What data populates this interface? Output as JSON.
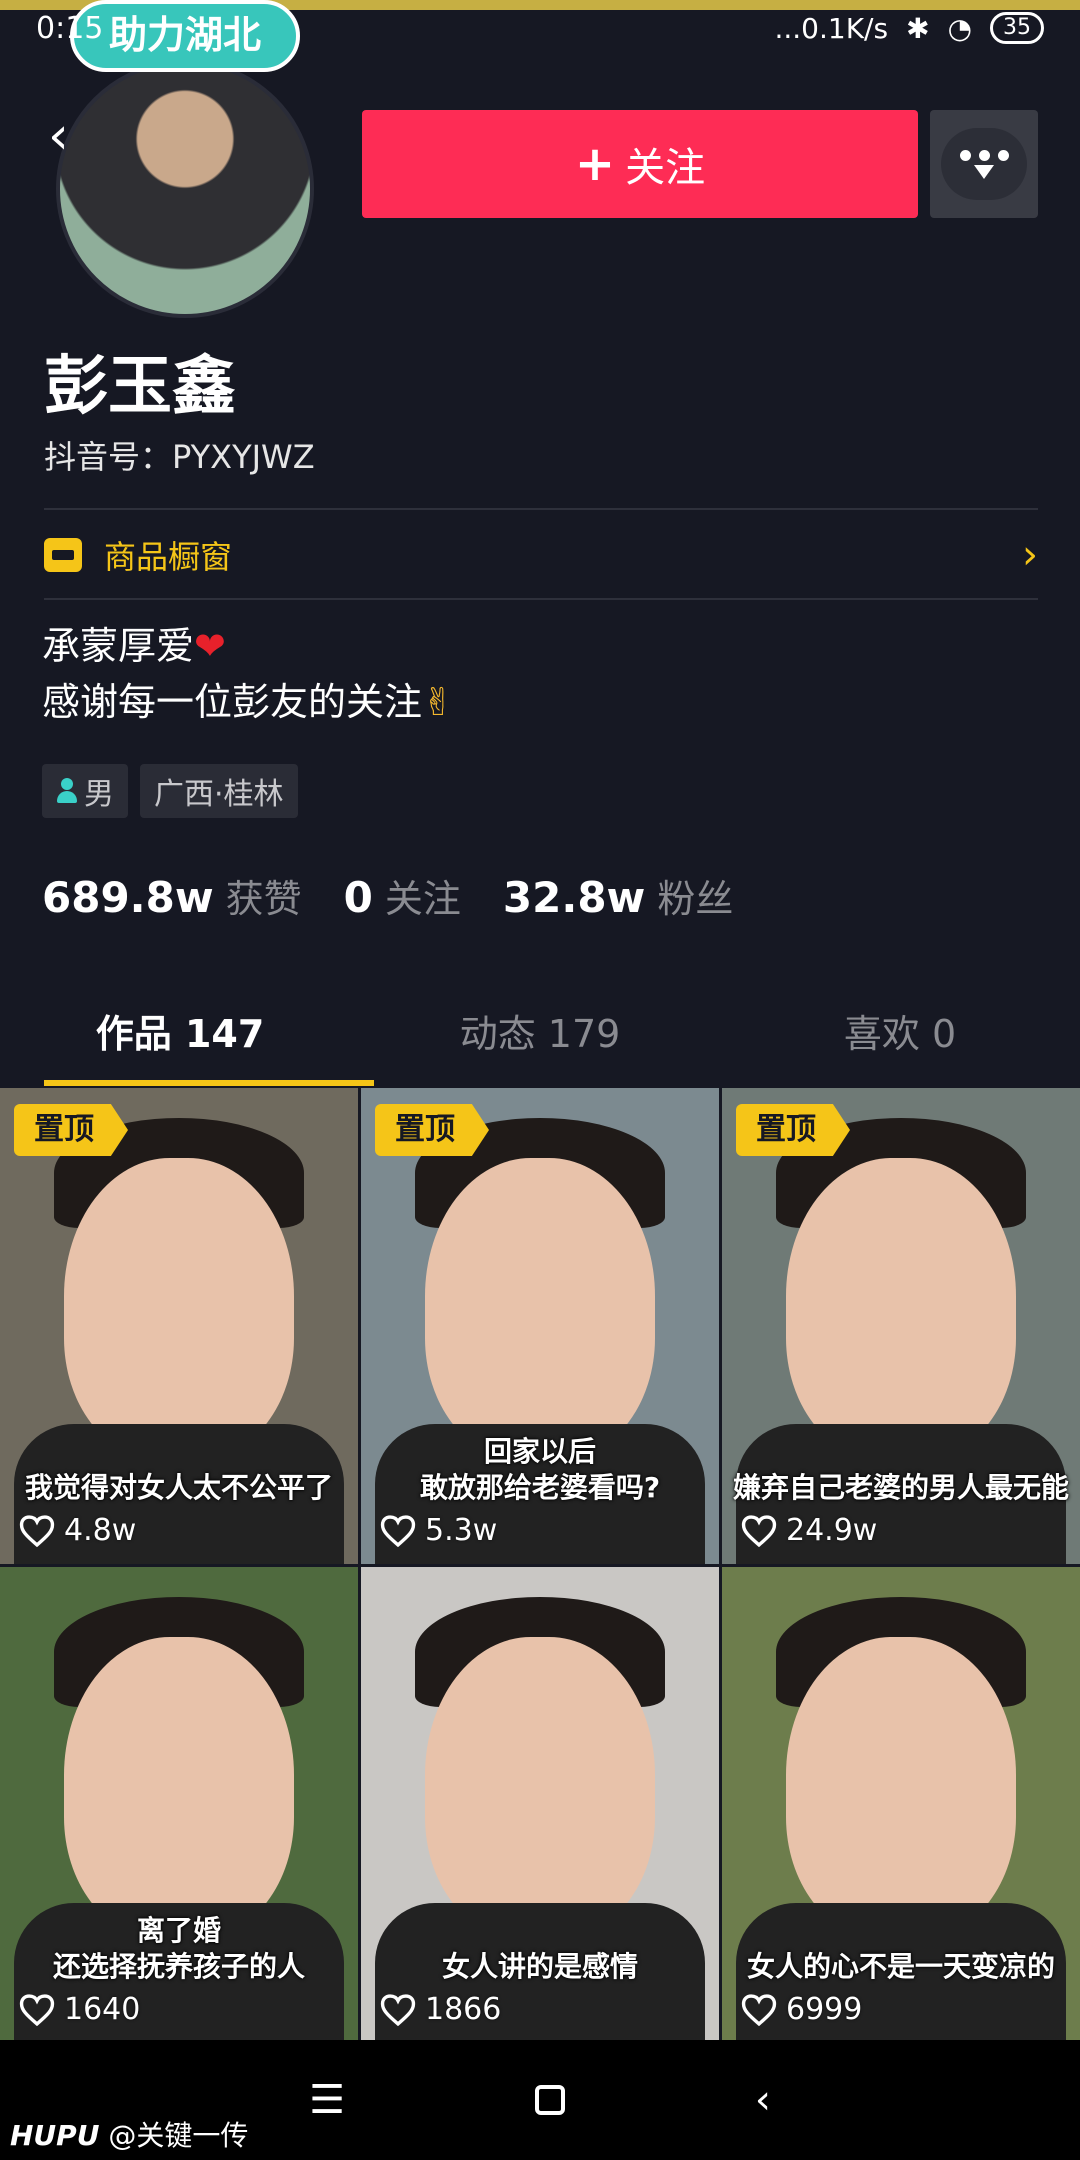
{
  "status_bar": {
    "time": "0:15",
    "net_speed": "...0.1K/s",
    "battery": "35"
  },
  "avatar_badge": "助力湖北",
  "header": {
    "back_label": "‹",
    "follow_label": "关注",
    "follow_plus": "+"
  },
  "profile": {
    "name": "彭玉鑫",
    "douyin_id": "抖音号：PYXYJWZ",
    "shop_label": "商品橱窗",
    "bio_line1": "承蒙厚爱",
    "bio_line2": "感谢每一位彭友的关注",
    "tags": [
      {
        "label": "男"
      },
      {
        "label": "广西·桂林"
      }
    ],
    "stats": [
      {
        "num": "689.8w",
        "label": "获赞"
      },
      {
        "num": "0",
        "label": "关注"
      },
      {
        "num": "32.8w",
        "label": "粉丝"
      }
    ]
  },
  "tabs": [
    {
      "label": "作品 147",
      "active": true
    },
    {
      "label": "动态 179",
      "active": false
    },
    {
      "label": "喜欢 0",
      "active": false
    }
  ],
  "videos": [
    {
      "pinned": "置顶",
      "caption": "我觉得对女人太不公平了",
      "likes": "4.8w",
      "bg": "#6f6a5e"
    },
    {
      "pinned": "置顶",
      "caption": "回家以后\n敢放那给老婆看吗?",
      "likes": "5.3w",
      "bg": "#7c8a90"
    },
    {
      "pinned": "置顶",
      "caption": "嫌弃自己老婆的男人最无能",
      "likes": "24.9w",
      "bg": "#6f7a76"
    },
    {
      "pinned": "",
      "caption": "离了婚\n还选择抚养孩子的人",
      "likes": "1640",
      "bg": "#4f6a3e"
    },
    {
      "pinned": "",
      "caption": "女人讲的是感情",
      "likes": "1866",
      "bg": "#c9c7c4"
    },
    {
      "pinned": "",
      "caption": "女人的心不是一天变凉的",
      "likes": "6999",
      "bg": "#6d7d4c"
    }
  ],
  "watermark": {
    "brand": "HUPU",
    "handle": "@关键一传"
  }
}
